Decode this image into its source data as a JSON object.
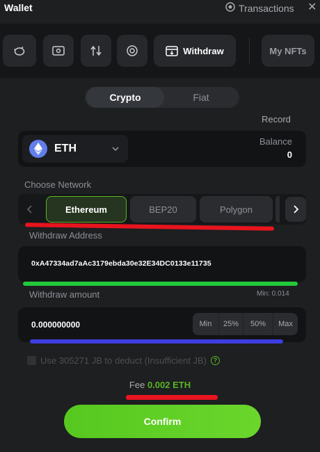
{
  "header": {
    "title": "Wallet",
    "transactions_label": "Transactions",
    "close_glyph": "✕"
  },
  "tabs": {
    "icons": [
      "piggy-bank-icon",
      "cash-icon",
      "transfer-arrows-icon",
      "coin-swap-icon",
      "withdraw-icon"
    ],
    "active_label": "Withdraw",
    "nft_label": "My NFTs"
  },
  "segment": {
    "crypto": "Crypto",
    "fiat": "Fiat",
    "selected": "Crypto"
  },
  "record_label": "Record",
  "asset": {
    "symbol": "ETH",
    "balance_label": "Balance",
    "balance_value": "0"
  },
  "network": {
    "label": "Choose Network",
    "options": [
      "Ethereum",
      "BEP20",
      "Polygon"
    ],
    "selected": "Ethereum"
  },
  "address": {
    "label": "Withdraw Address",
    "value": "0xA47334ad7aAc3179ebda30e32E34DC0133e11735"
  },
  "amount": {
    "label": "Withdraw amount",
    "min_text": "Min: 0.014",
    "value": "0.000000000",
    "quick_buttons": [
      "Min",
      "25%",
      "50%",
      "Max"
    ]
  },
  "deduct": {
    "label": "Use 305271 JB to deduct (Insufficient JB)",
    "help_glyph": "?"
  },
  "fee": {
    "label": "Fee",
    "value": "0.002 ETH"
  },
  "confirm_label": "Confirm",
  "colors": {
    "accent_green": "#5ab522",
    "eth_blue": "#627eea",
    "annot_red": "#e8141e",
    "annot_green": "#22c93a",
    "annot_blue": "#3d3de0"
  }
}
